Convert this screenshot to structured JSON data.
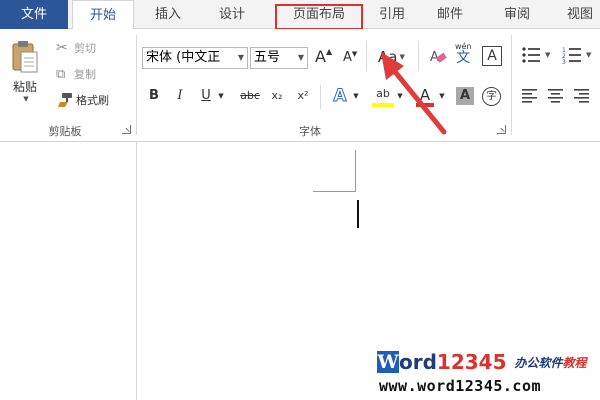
{
  "tabs": {
    "file": "文件",
    "home": "开始",
    "insert": "插入",
    "design": "设计",
    "layout": "页面布局",
    "references": "引用",
    "mailings": "邮件",
    "review": "审阅",
    "view": "视图"
  },
  "clipboard": {
    "paste": "粘贴",
    "cut": "剪切",
    "copy": "复制",
    "format_painter": "格式刷",
    "group_label": "剪贴板"
  },
  "font": {
    "font_name": "宋体 (中文正",
    "font_size": "五号",
    "grow_font": "A",
    "shrink_font": "A",
    "change_case": "Aa",
    "phonetic_top": "wén",
    "phonetic_char": "文",
    "char_border": "A",
    "bold": "B",
    "italic": "I",
    "underline": "U",
    "strikethrough": "abc",
    "subscript": "x₂",
    "superscript": "x²",
    "text_effects": "A",
    "highlight": "ab",
    "font_color": "A",
    "char_shading": "A",
    "enclose_char": "字",
    "group_label": "字体"
  },
  "watermark": {
    "logo_letter": "W",
    "logo_word": "ord",
    "logo_number": "12345",
    "tagline_a": "办公软件",
    "tagline_b": "教程",
    "url": "www.word12345.com"
  },
  "colors": {
    "file_tab": "#2b579a",
    "highlight_box": "#d9322f",
    "arrow": "#e03c3c",
    "highlight_yellow": "#ffff00",
    "font_color_red": "#d9322f"
  }
}
